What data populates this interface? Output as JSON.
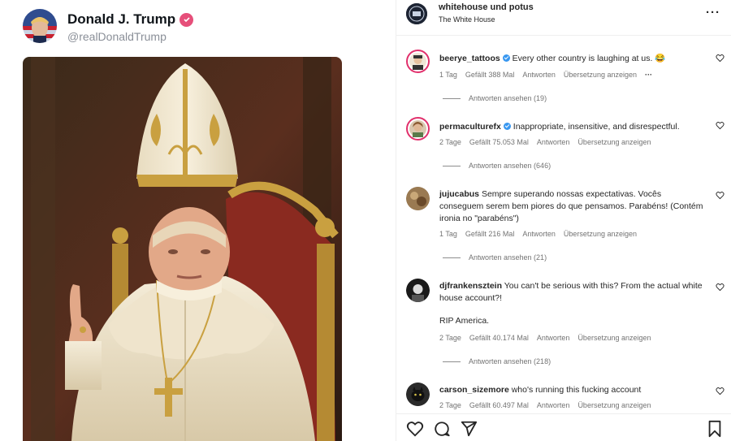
{
  "post": {
    "author_name": "Donald J. Trump",
    "author_handle": "@realDonaldTrump"
  },
  "header": {
    "title": "whitehouse und potus",
    "subtitle": "The White House"
  },
  "comments": [
    {
      "user": "beerye_tattoos",
      "verified": true,
      "text": "Every other country is laughing at us. 😂",
      "time": "1 Tag",
      "likes": "Gefällt 388 Mal",
      "reply": "Antworten",
      "translate": "Übersetzung anzeigen",
      "more": "···",
      "replies": "Antworten ansehen (19)"
    },
    {
      "user": "permaculturefx",
      "verified": true,
      "text": "Inappropriate, insensitive, and disrespectful.",
      "time": "2 Tage",
      "likes": "Gefällt 75.053 Mal",
      "reply": "Antworten",
      "translate": "Übersetzung anzeigen",
      "replies": "Antworten ansehen (646)"
    },
    {
      "user": "jujucabus",
      "verified": false,
      "text": "Sempre superando nossas expectativas. Vocês conseguem serem bem piores do que pensamos. Parabéns! (Contém ironia no \"parabéns\")",
      "time": "1 Tag",
      "likes": "Gefällt 216 Mal",
      "reply": "Antworten",
      "translate": "Übersetzung anzeigen",
      "replies": "Antworten ansehen (21)"
    },
    {
      "user": "djfrankensztein",
      "verified": false,
      "text": "You can't be serious with this? From the actual white house account?!",
      "text2": "RIP America.",
      "time": "2 Tage",
      "likes": "Gefällt 40.174 Mal",
      "reply": "Antworten",
      "translate": "Übersetzung anzeigen",
      "replies": "Antworten ansehen (218)"
    },
    {
      "user": "carson_sizemore",
      "verified": false,
      "text": "who's running this fucking account",
      "time": "2 Tage",
      "likes": "Gefällt 60.497 Mal",
      "reply": "Antworten",
      "translate": "Übersetzung anzeigen"
    }
  ],
  "icons": {
    "like": "heart-icon",
    "comment": "comment-icon",
    "share": "share-icon",
    "save": "bookmark-icon",
    "options": "more-icon"
  },
  "colors": {
    "verified_blue": "#3897f0",
    "story_ring": "#e1306c",
    "meta_gray": "#737373"
  }
}
